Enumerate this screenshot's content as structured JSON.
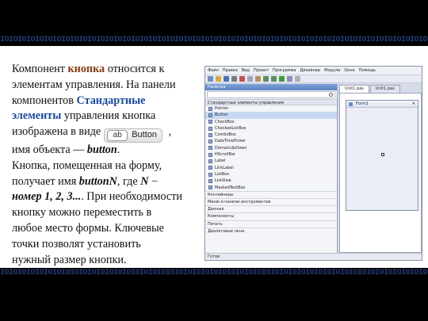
{
  "band_pattern": "IOIOIOIOIOIOIOIOIOIOIOIOIOIOIOIOIOIOIOIOIOIOIOIOIOIOIOIOIOIOIOIOIOIOIOIOIOIOIOIOIOIOIOIOIOIOIOIOIOIOIOIOIOIOIOIOIOIOIO",
  "text": {
    "l1a": "Компонент ",
    "l1kw": "кнопка",
    "l1b": " относится к",
    "l2": "элементам управления. На панели",
    "l3a": "компонентов ",
    "l3kw": "Стандартные",
    "l4kw": "элементы",
    "l4b": " управления кнопка",
    "l5a": "изображена  в  виде",
    "l5b": " ,",
    "l6a": "имя  объекта   —  ",
    "l6obj": "button",
    "l6b": ".",
    "l7": "Кнопка,  помещенная  на  форму,",
    "l8a": "получает имя ",
    "l8name": "buttonN",
    "l8b": ", где ",
    "l8n": "N",
    "l8c": " −",
    "l9a": "номер ",
    "l9nums": "1, 2, 3...",
    "l9b": ". При необходимости",
    "l10": "кнопку можно переместить в",
    "l11": "любое место формы. Ключевые",
    "l12": "точки позволят установить",
    "l13": "нужный  размер  кнопки."
  },
  "inline_button": {
    "icon_text": "ab",
    "label": "Button"
  },
  "ide": {
    "menu": [
      "Файл",
      "Правка",
      "Вид",
      "Проект",
      "Программа",
      "Дизайнер",
      "Модули",
      "Окно",
      "Помощь"
    ],
    "palette_title": "Палитра",
    "category": "Стандартные элементы управления",
    "items": [
      "Pointer",
      "Button",
      "CheckBox",
      "CheckedListBox",
      "ComboBox",
      "DateTimePicker",
      "DomainUpDown",
      "HScrollBar",
      "Label",
      "LinkLabel",
      "ListBox",
      "ListView",
      "MaskedTextBox"
    ],
    "closed_categories": [
      "Контейнеры",
      "Меню и панели инструментов",
      "Данные",
      "Компоненты",
      "Печать",
      "Диалоговые окна"
    ],
    "status": "Готов",
    "tabs": [
      "Unit1.pas",
      "Unit1.pas"
    ],
    "designer_tabs": [
      "Форма",
      "Код"
    ],
    "form_caption": "Form1"
  }
}
